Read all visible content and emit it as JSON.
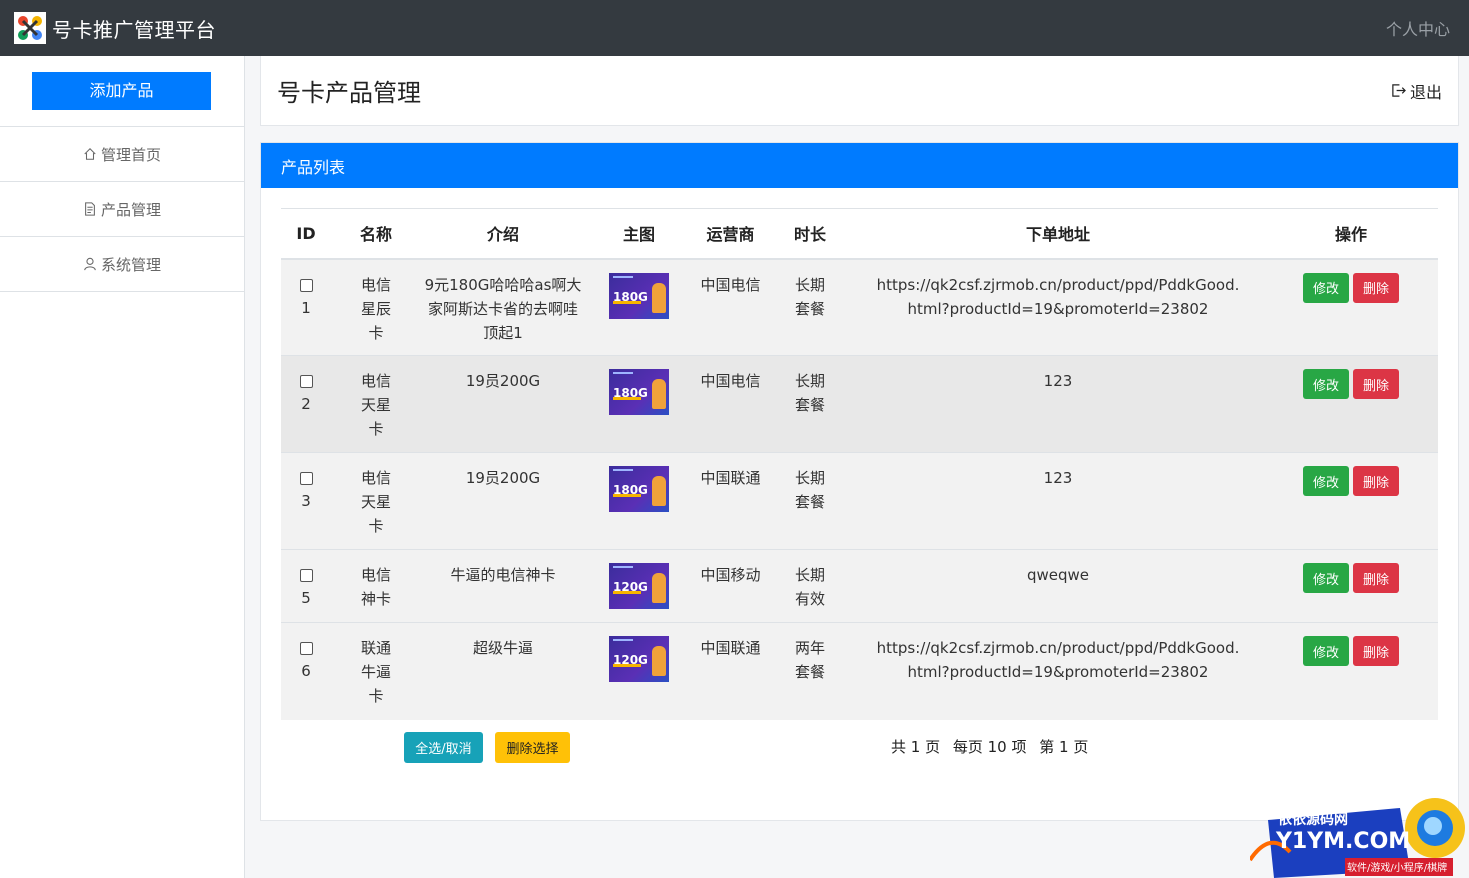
{
  "topbar": {
    "title": "号卡推广管理平台",
    "user_center": "个人中心"
  },
  "sidebar": {
    "add_button": "添加产品",
    "items": [
      {
        "label": "管理首页",
        "icon": "home-icon"
      },
      {
        "label": "产品管理",
        "icon": "document-icon"
      },
      {
        "label": "系统管理",
        "icon": "user-icon"
      }
    ]
  },
  "header": {
    "title": "号卡产品管理",
    "logout": "退出"
  },
  "card": {
    "title": "产品列表"
  },
  "table": {
    "columns": [
      "ID",
      "名称",
      "介绍",
      "主图",
      "运营商",
      "时长",
      "下单地址",
      "操作"
    ],
    "rows": [
      {
        "id": "1",
        "name": "电信\n星辰\n卡",
        "intro": "9元180G哈哈哈as啊大家阿斯达卡省的去啊哇顶起1",
        "image": "180G",
        "carrier": "中国电信",
        "duration": "长期\n套餐",
        "url": "https://qk2csf.zjrmob.cn/product/ppd/PddkGood.html?productId=19&promoterId=23802"
      },
      {
        "id": "2",
        "name": "电信\n天星\n卡",
        "intro": "19员200G",
        "image": "180G",
        "carrier": "中国电信",
        "duration": "长期\n套餐",
        "url": "123"
      },
      {
        "id": "3",
        "name": "电信\n天星\n卡",
        "intro": "19员200G",
        "image": "180G",
        "carrier": "中国联通",
        "duration": "长期\n套餐",
        "url": "123"
      },
      {
        "id": "5",
        "name": "电信\n神卡",
        "intro": "牛逼的电信神卡",
        "image": "120G",
        "carrier": "中国移动",
        "duration": "长期\n有效",
        "url": "qweqwe"
      },
      {
        "id": "6",
        "name": "联通\n牛逼\n卡",
        "intro": "超级牛逼",
        "image": "120G",
        "carrier": "中国联通",
        "duration": "两年\n套餐",
        "url": "https://qk2csf.zjrmob.cn/product/ppd/PddkGood.html?productId=19&promoterId=23802"
      }
    ],
    "edit_label": "修改",
    "delete_label": "删除"
  },
  "footer": {
    "select_all": "全选/取消",
    "delete_selected": "删除选择",
    "total_pages": "共 1 页",
    "per_page": "每页 10 项",
    "current_page": "第 1 页"
  },
  "watermark": {
    "line1": "依依源码网",
    "line2": "Y1YM.COM",
    "line3": "软件/游戏/小程序/棋牌"
  },
  "colors": {
    "topbar": "#343a40",
    "primary": "#007bff",
    "success": "#28a745",
    "danger": "#dc3545",
    "info": "#17a2b8",
    "warning": "#ffc107"
  }
}
